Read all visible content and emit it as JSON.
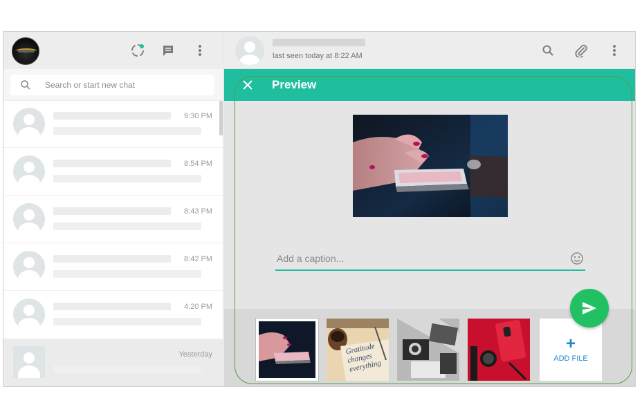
{
  "sidebar": {
    "search": {
      "placeholder": "Search or start new chat",
      "value": ""
    },
    "chats": [
      {
        "time": "9:30 PM"
      },
      {
        "time": "8:54 PM"
      },
      {
        "time": "8:43 PM"
      },
      {
        "time": "8:42 PM"
      },
      {
        "time": "4:20 PM"
      },
      {
        "time": "Yesterday"
      }
    ],
    "icons": [
      "status-icon",
      "new-chat-icon",
      "menu-icon"
    ]
  },
  "conversation": {
    "last_seen": "last seen today at 8:22 AM",
    "icons": [
      "search-icon",
      "attach-icon",
      "menu-icon"
    ]
  },
  "preview": {
    "title": "Preview",
    "caption": {
      "placeholder": "Add a caption...",
      "value": ""
    },
    "add_file": {
      "plus": "+",
      "label": "ADD FILE"
    },
    "thumb_text": {
      "line1": "Gratitude",
      "line2": "changes",
      "line3": "everything"
    }
  },
  "colors": {
    "accent": "#1fbe9e",
    "send": "#21c063",
    "add_file": "#1e88c8",
    "outline": "#5a9a4a"
  }
}
